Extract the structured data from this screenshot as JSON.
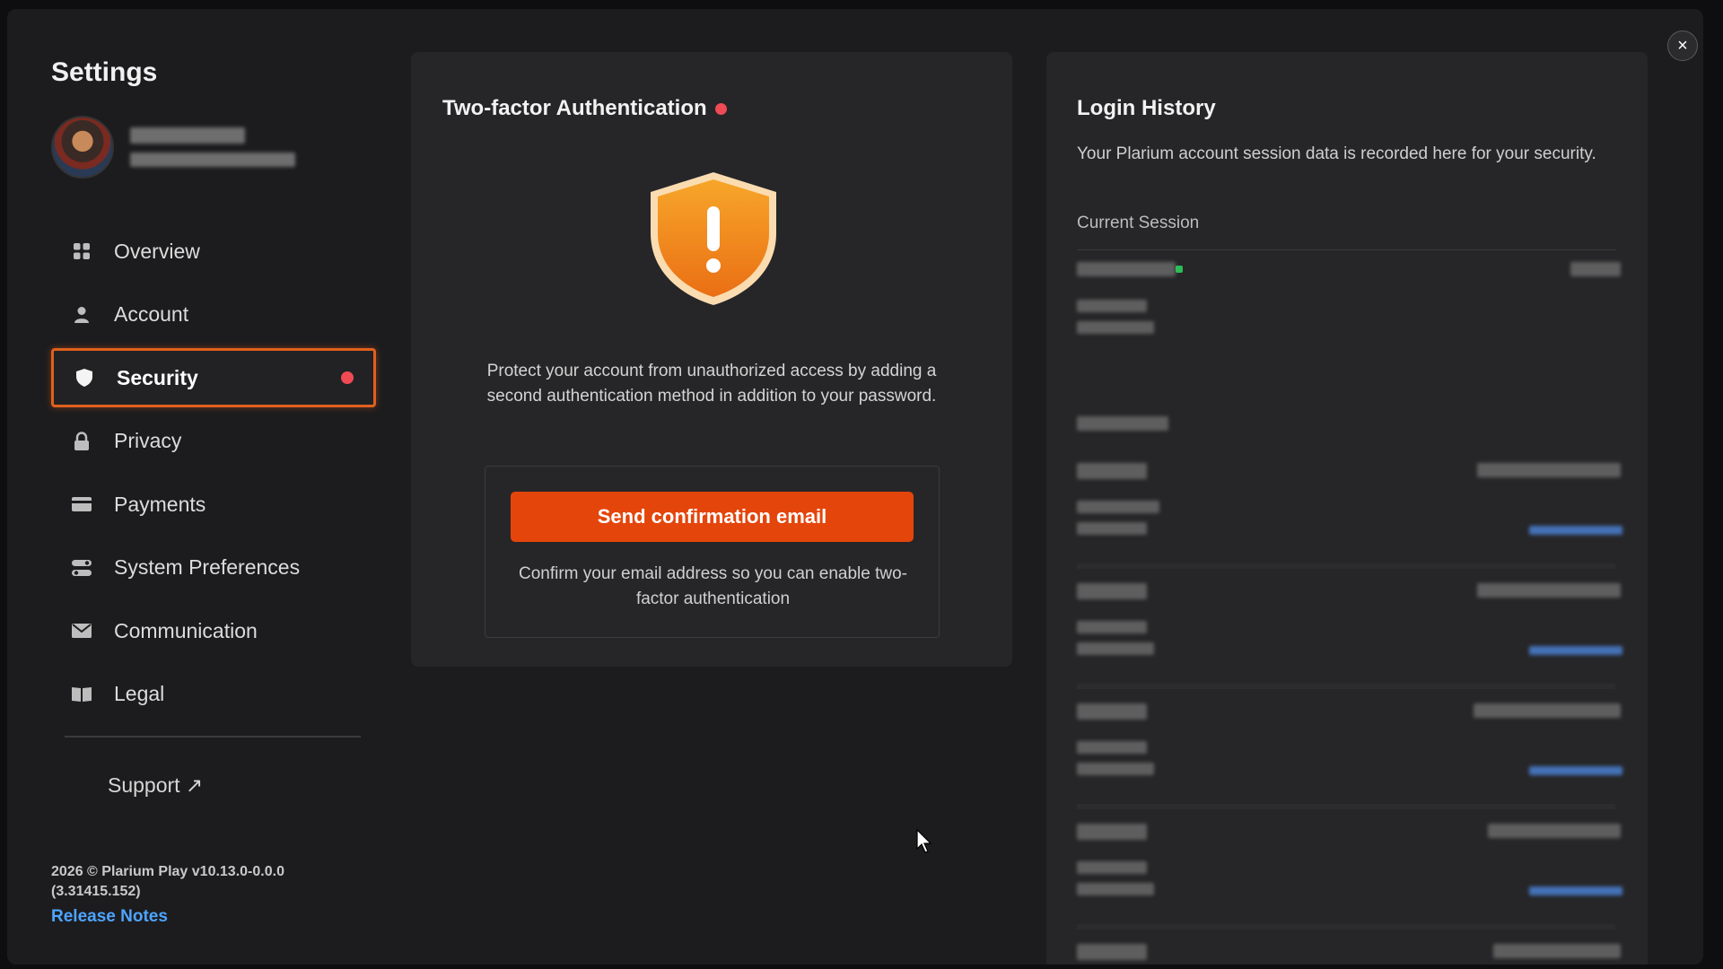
{
  "settings": {
    "title": "Settings",
    "close_label": "×"
  },
  "sidebar": {
    "items": [
      {
        "label": "Overview",
        "icon": "grid-icon"
      },
      {
        "label": "Account",
        "icon": "user-icon"
      },
      {
        "label": "Security",
        "icon": "shield-icon",
        "active": true
      },
      {
        "label": "Privacy",
        "icon": "lock-icon"
      },
      {
        "label": "Payments",
        "icon": "card-icon"
      },
      {
        "label": "System Preferences",
        "icon": "toggle-icon"
      },
      {
        "label": "Communication",
        "icon": "envelope-icon"
      },
      {
        "label": "Legal",
        "icon": "book-icon"
      }
    ],
    "support_label": "Support ↗",
    "version": "2026 © Plarium Play v10.13.0-0.0.0 (3.31415.152)",
    "release_notes": "Release Notes"
  },
  "two_factor": {
    "title": "Two-factor Authentication",
    "description": "Protect your account from unauthorized access by adding a second authentication method in addition to your password.",
    "button_label": "Send confirmation email",
    "confirm_note": "Confirm your email address so you can enable two-factor authentication"
  },
  "login_history": {
    "title": "Login History",
    "description": "Your Plarium account session data is recorded here for your security.",
    "current_session_label": "Current Session"
  },
  "colors": {
    "accent": "#e4450b",
    "alert_dot": "#f04a55",
    "link": "#4ea4ff",
    "shield": "#f0901e"
  }
}
